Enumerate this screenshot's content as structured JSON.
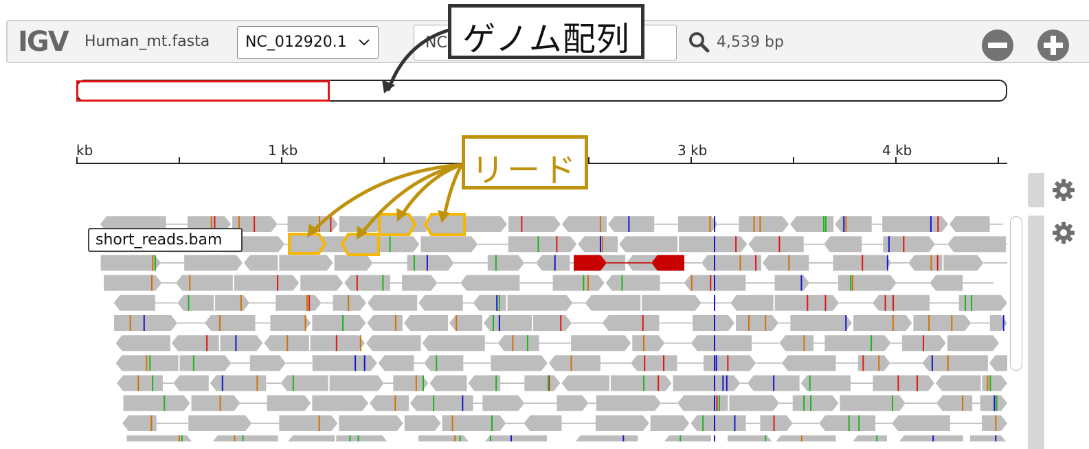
{
  "navbar": {
    "logo": "IGV",
    "genome": "Human_mt.fasta",
    "chromosome": "NC_012920.1",
    "locus_visible": "NC",
    "bp": "4,539 bp"
  },
  "icons": {
    "search": "search-icon",
    "zoom_out": "minus-circle-icon",
    "zoom_in": "plus-circle-icon",
    "settings": "gear-icon",
    "dropdown": "chevron-down-icon"
  },
  "ruler": {
    "labels": [
      "kb",
      "1 kb",
      "3 kb",
      "4 kb"
    ]
  },
  "track": {
    "name": "short_reads.bam"
  },
  "annotations": {
    "genome": "ゲノム配列",
    "reads": "リード"
  },
  "colors": {
    "read": "#bdbdbd",
    "selected_read": "#c80000",
    "highlight": "#f5b700",
    "reads_callout": "#bf920d",
    "ideogram_view": "#e21414",
    "mismatch_A": "#1db31d",
    "mismatch_C": "#1414cc",
    "mismatch_G": "#d17105",
    "mismatch_T": "#e21414"
  }
}
